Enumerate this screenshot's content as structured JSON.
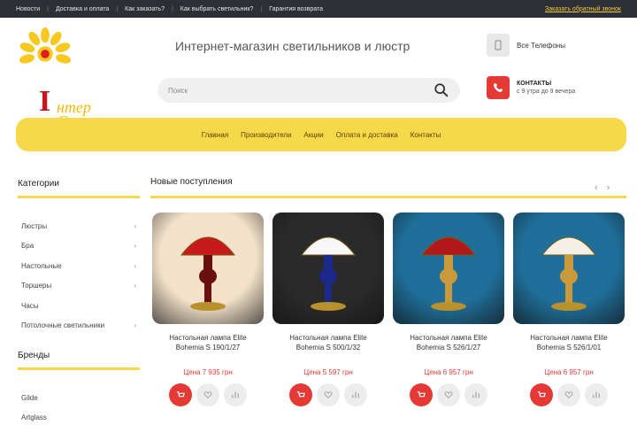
{
  "topbar": {
    "links": [
      "Новости",
      "Доставка и оплата",
      "Как заказать?",
      "Как выбрать светильник?",
      "Гарантия возврата"
    ],
    "callback": "Заказать обратный звонок"
  },
  "logo": {
    "big_letter": "I",
    "word1": "нтер",
    "word2": "Свет"
  },
  "header": {
    "tagline": "Интернет-магазин светильников и люстр",
    "search_placeholder": "Поиск",
    "contacts_label": "Все Телефоны",
    "phone_title": "КОНТАКТЫ",
    "phone_subtitle": "с 9 утра до 9 вечера"
  },
  "nav": {
    "items": [
      "Главная",
      "Производители",
      "Акции",
      "Оплата и доставка",
      "Контакты"
    ]
  },
  "sidebar": {
    "categories_title": "Категории",
    "categories": [
      {
        "label": "Люстры",
        "has_children": true
      },
      {
        "label": "Бра",
        "has_children": true
      },
      {
        "label": "Настольные",
        "has_children": true
      },
      {
        "label": "Торшеры",
        "has_children": true
      },
      {
        "label": "Часы",
        "has_children": false
      },
      {
        "label": "Потолочные светильники",
        "has_children": true
      }
    ],
    "brands_title": "Бренды",
    "brands": [
      "Gilde",
      "Artglass"
    ]
  },
  "main": {
    "section_title": "Новые поступления",
    "products": [
      {
        "name": "Настольная лампа Elite Bohemia S 190/1/27",
        "price": "Цена 7 935 грн",
        "shade": "#c81a1a",
        "body": "#6b1010",
        "bg": "#f3e1c9"
      },
      {
        "name": "Настольная лампа Elite Bohemia S 500/1/32",
        "price": "Цена 5 597 грн",
        "shade": "#f7f7f7",
        "body": "#1b2a8a",
        "bg": "#2a2a2a"
      },
      {
        "name": "Настольная лампа Elite Bohemia S 526/1/27",
        "price": "Цена 6 957 грн",
        "shade": "#b0181a",
        "body": "#c99a3a",
        "bg": "#1f6f9a"
      },
      {
        "name": "Настольная лампа Elite Bohemia S 526/1/01",
        "price": "Цена 6 957 грн",
        "shade": "#f5f0e6",
        "body": "#c99a3a",
        "bg": "#1f6f9a"
      }
    ]
  },
  "colors": {
    "accent_yellow": "#f7d84a",
    "accent_red": "#e53935",
    "topbar": "#2c2f33"
  }
}
